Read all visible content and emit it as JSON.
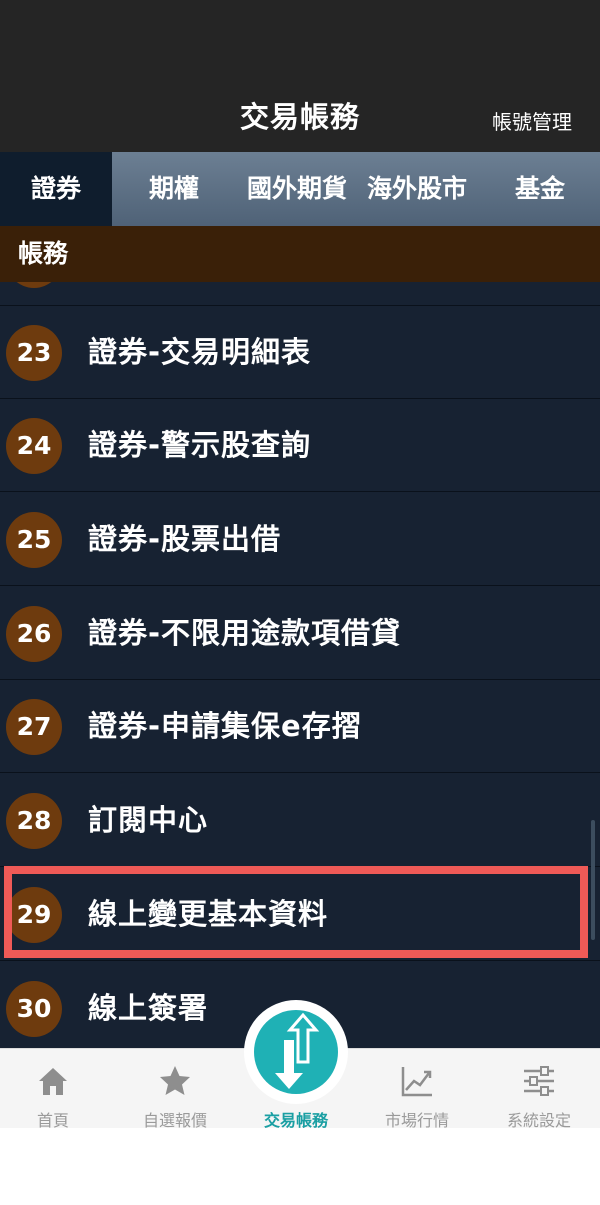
{
  "header": {
    "title": "交易帳務",
    "action": "帳號管理"
  },
  "tabs": [
    {
      "label": "證券",
      "active": true
    },
    {
      "label": "期權",
      "active": false
    },
    {
      "label": "國外期貨",
      "active": false
    },
    {
      "label": "海外股市",
      "active": false
    },
    {
      "label": "基金",
      "active": false
    }
  ],
  "section": {
    "title": "帳務"
  },
  "list": [
    {
      "num": "23",
      "label": "證券-交易明細表"
    },
    {
      "num": "24",
      "label": "證券-警示股查詢"
    },
    {
      "num": "25",
      "label": "證券-股票出借"
    },
    {
      "num": "26",
      "label": "證券-不限用途款項借貸"
    },
    {
      "num": "27",
      "label": "證券-申請集保e存摺"
    },
    {
      "num": "28",
      "label": "訂閱中心"
    },
    {
      "num": "29",
      "label": "線上變更基本資料"
    },
    {
      "num": "30",
      "label": "線上簽署"
    }
  ],
  "tabbar": [
    {
      "label": "首頁",
      "icon": "home-icon",
      "active": false
    },
    {
      "label": "自選報價",
      "icon": "star-icon",
      "active": false
    },
    {
      "label": "交易帳務",
      "icon": "trade-arrows-icon",
      "active": true
    },
    {
      "label": "市場行情",
      "icon": "chart-trend-icon",
      "active": false
    },
    {
      "label": "系統設定",
      "icon": "sliders-icon",
      "active": false
    }
  ],
  "colors": {
    "header_bg": "#252525",
    "list_bg": "#172232",
    "section_bg": "#3a2008",
    "number_badge": "#6e3b0e",
    "highlight_border": "#ef5a57",
    "accent": "#1fb1b5"
  }
}
